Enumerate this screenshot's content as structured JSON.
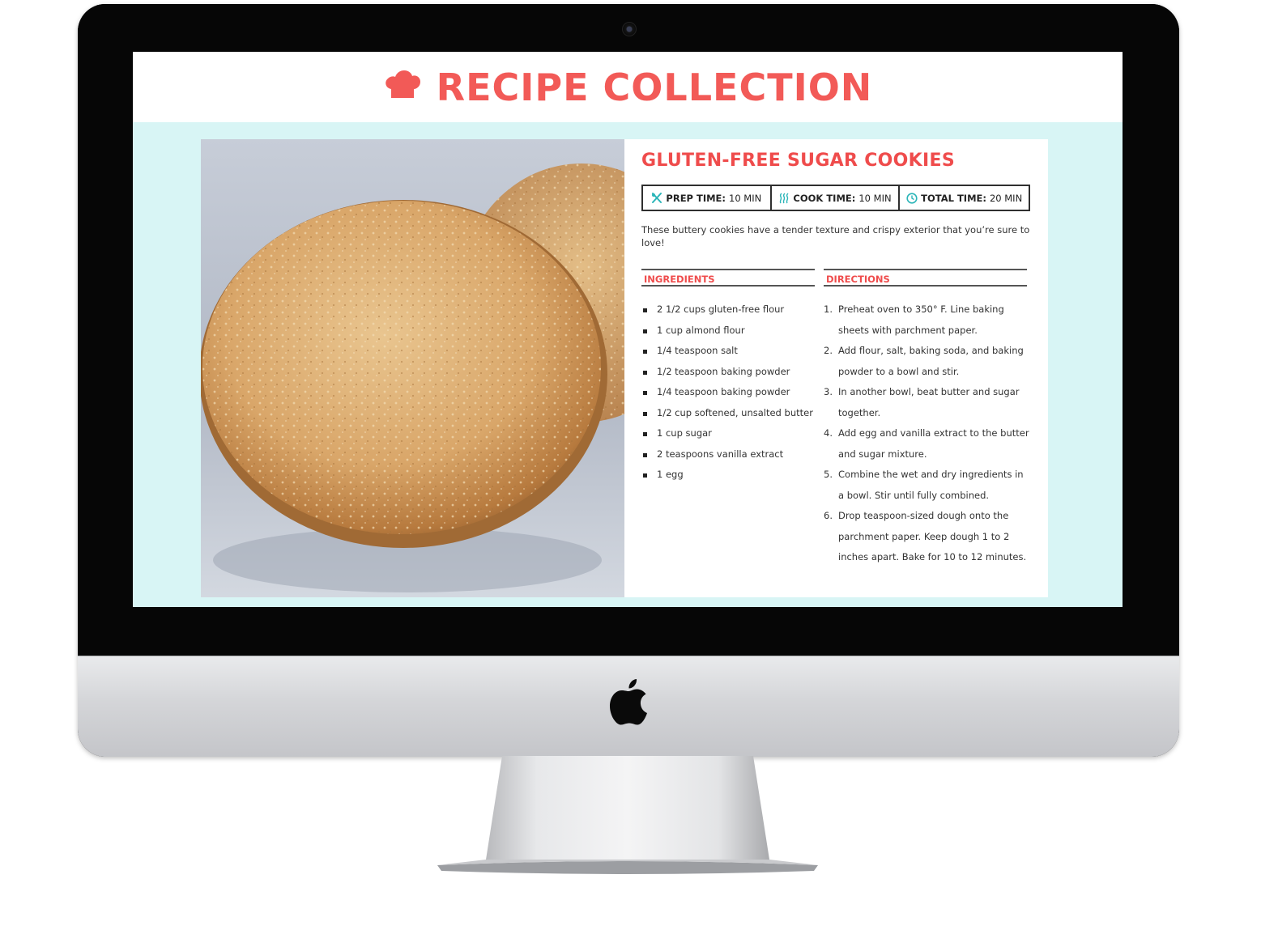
{
  "site": {
    "title": "RECIPE COLLECTION",
    "logo_icon": "chef-hat-icon",
    "brand_color": "#f25a57"
  },
  "recipe": {
    "title": "GLUTEN-FREE SUGAR COOKIES",
    "times": [
      {
        "icon": "utensils-icon",
        "label": "PREP TIME:",
        "value": "10 MIN"
      },
      {
        "icon": "heat-waves-icon",
        "label": "COOK TIME:",
        "value": "10 MIN"
      },
      {
        "icon": "clock-icon",
        "label": "TOTAL TIME:",
        "value": "20 MIN"
      }
    ],
    "description": "These buttery cookies have a tender texture and crispy exterior that you’re sure to love!",
    "ingredients_heading": "INGREDIENTS",
    "directions_heading": "DIRECTIONS",
    "ingredients": [
      "2 1/2 cups gluten-free flour",
      "1 cup almond flour",
      "1/4 teaspoon salt",
      "1/2 teaspoon baking powder",
      "1/4 teaspoon baking powder",
      "1/2 cup softened, unsalted butter",
      "1 cup sugar",
      "2 teaspoons vanilla extract",
      "1 egg"
    ],
    "directions": [
      {
        "num": "1.",
        "text": "Preheat oven to 350° F. Line baking sheets with parchment paper."
      },
      {
        "num": "2.",
        "text": "Add flour, salt, baking soda, and baking powder to a bowl and stir."
      },
      {
        "num": "3.",
        "text": "In another bowl, beat butter and sugar together."
      },
      {
        "num": "4.",
        "text": "Add egg and vanilla extract to the butter and sugar mixture."
      },
      {
        "num": "5.",
        "text": "Combine the wet and dry ingredients in a bowl. Stir until fully combined."
      },
      {
        "num": "6.",
        "text": "Drop teaspoon-sized dough onto the parchment paper. Keep dough 1 to 2 inches apart. Bake for 10 to 12 minutes."
      }
    ],
    "accent_color": "#ef4c4c",
    "icon_color": "#2bb5b8"
  },
  "device": {
    "logo_icon": "apple-logo-icon"
  }
}
